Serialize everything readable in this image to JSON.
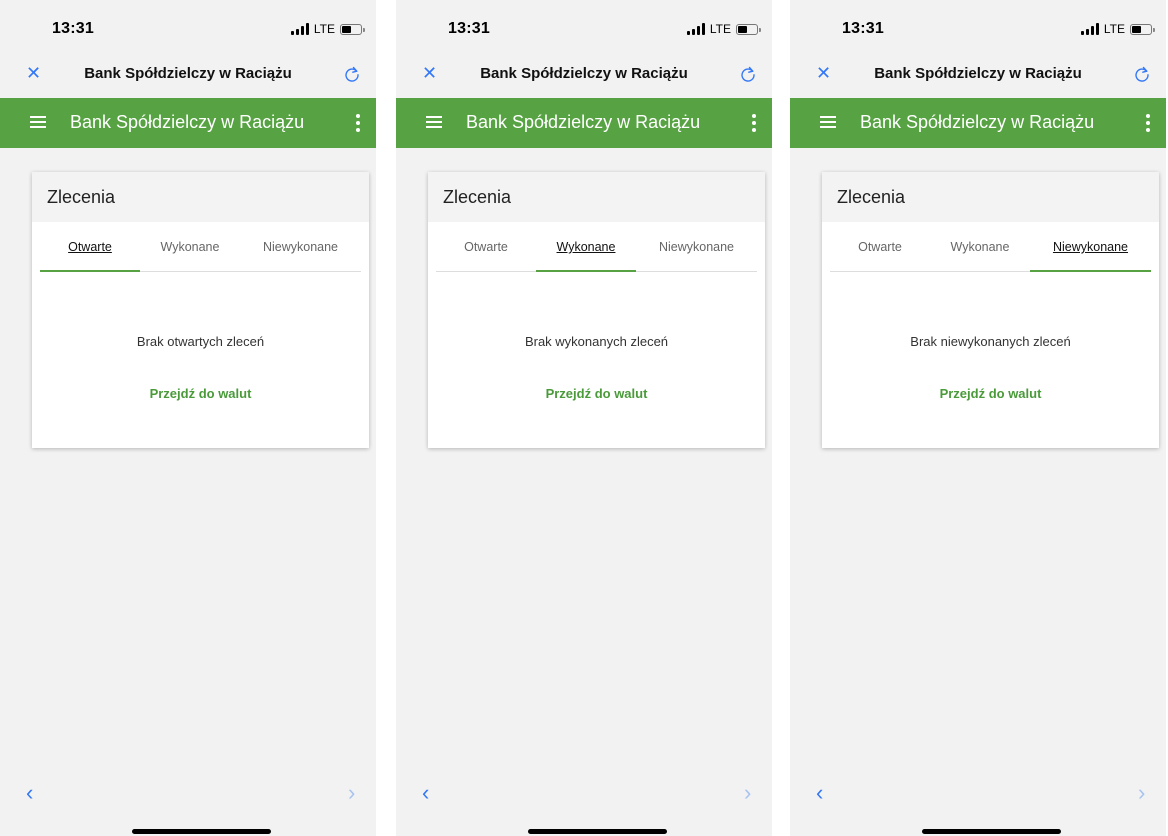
{
  "screens": [
    {
      "status": {
        "time": "13:31",
        "network": "LTE"
      },
      "browser": {
        "title": "Bank Spółdzielczy w Raciążu"
      },
      "app": {
        "title": "Bank Spółdzielczy w Raciążu"
      },
      "card": {
        "title": "Zlecenia",
        "tabs": [
          "Otwarte",
          "Wykonane",
          "Niewykonane"
        ],
        "active_tab": "Otwarte",
        "empty_message": "Brak otwartych zleceń",
        "link": "Przejdź do walut"
      }
    },
    {
      "status": {
        "time": "13:31",
        "network": "LTE"
      },
      "browser": {
        "title": "Bank Spółdzielczy w Raciążu"
      },
      "app": {
        "title": "Bank Spółdzielczy w Raciążu"
      },
      "card": {
        "title": "Zlecenia",
        "tabs": [
          "Otwarte",
          "Wykonane",
          "Niewykonane"
        ],
        "active_tab": "Wykonane",
        "empty_message": "Brak wykonanych zleceń",
        "link": "Przejdź do walut"
      }
    },
    {
      "status": {
        "time": "13:31",
        "network": "LTE"
      },
      "browser": {
        "title": "Bank Spółdzielczy w Raciążu"
      },
      "app": {
        "title": "Bank Spółdzielczy w Raciążu"
      },
      "card": {
        "title": "Zlecenia",
        "tabs": [
          "Otwarte",
          "Wykonane",
          "Niewykonane"
        ],
        "active_tab": "Niewykonane",
        "empty_message": "Brak niewykonanych zleceń",
        "link": "Przejdź do walut"
      }
    }
  ],
  "icons": [
    "close-icon",
    "reload-icon",
    "menu-icon",
    "kebab-icon",
    "back-arrow-icon",
    "forward-arrow-icon",
    "signal-icon",
    "battery-icon"
  ],
  "colors": {
    "brand_green": "#57a343",
    "link_green": "#4a9a3a",
    "ios_blue": "#3478f6",
    "background": "#f2f2f2"
  }
}
